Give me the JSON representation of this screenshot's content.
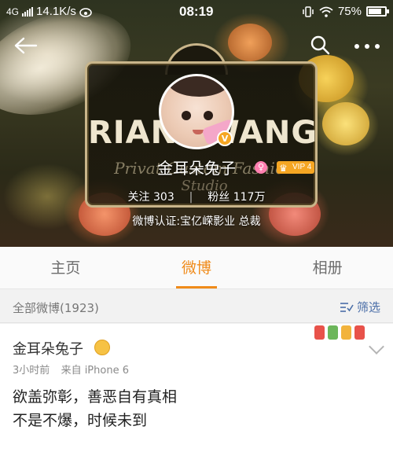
{
  "status_bar": {
    "network": "4G",
    "speed": "14.1K/s",
    "time": "08:19",
    "battery": "75%"
  },
  "banner": {
    "sign_text": "RIANNWANG",
    "sign_script_line1": "Privat Custom Fashion",
    "sign_script_line2": "Studio"
  },
  "profile": {
    "name": "金耳朵兔子",
    "vip_label": "VIP 4",
    "verified_badge": "V",
    "follow_label": "关注",
    "follow_count": "303",
    "fans_label": "粉丝",
    "fans_count": "117万",
    "verification": "微博认证:宝亿嵘影业 总裁"
  },
  "tabs": [
    {
      "label": "主页"
    },
    {
      "label": "微博"
    },
    {
      "label": "相册"
    }
  ],
  "filter_bar": {
    "all_posts": "全部微博(1923)",
    "filter_label": "筛选"
  },
  "post": {
    "author": "金耳朵兔子",
    "time": "3小时前",
    "source": "来自 iPhone 6",
    "line1": "欲盖弥彰，善恶自有真相",
    "line2": "不是不爆，时候未到"
  },
  "colors": {
    "accent": "#f08b1a",
    "link": "#4a6ea8",
    "vip": "#f5a623"
  },
  "icons": {
    "back": "back-arrow-icon",
    "search": "search-icon",
    "more": "more-icon",
    "filter": "filter-icon",
    "dropdown": "chevron-down-icon"
  }
}
